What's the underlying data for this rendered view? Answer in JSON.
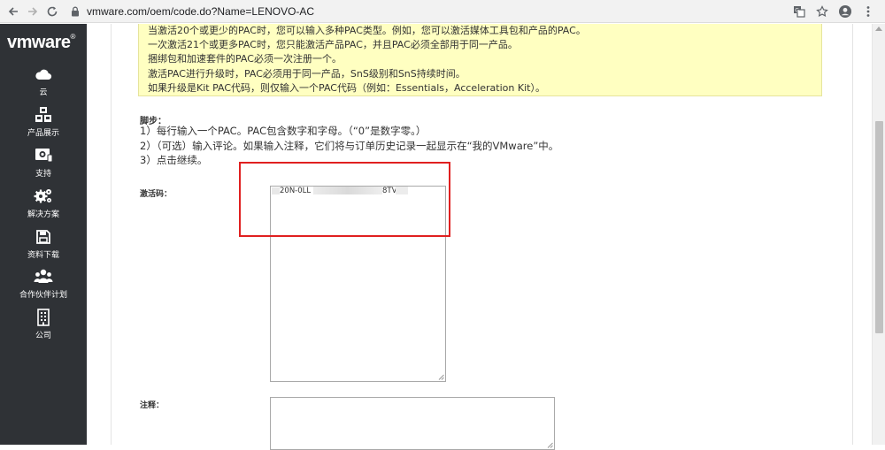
{
  "browser": {
    "url": "vmware.com/oem/code.do?Name=LENOVO-AC",
    "back_icon": "arrow-left-icon",
    "forward_icon": "arrow-right-icon",
    "reload_icon": "reload-icon"
  },
  "sidebar": {
    "logo": "vmware",
    "items": [
      {
        "label": "云",
        "icon": "cloud-icon"
      },
      {
        "label": "产品展示",
        "icon": "cubes-icon"
      },
      {
        "label": "支持",
        "icon": "support-icon"
      },
      {
        "label": "解决方案",
        "icon": "gears-icon"
      },
      {
        "label": "资料下载",
        "icon": "floppy-icon"
      },
      {
        "label": "合作伙伴计划",
        "icon": "people-icon"
      },
      {
        "label": "公司",
        "icon": "building-icon"
      }
    ]
  },
  "notice": {
    "lines": [
      "当激活20个或更少的PAC时，您可以输入多种PAC类型。例如，您可以激活媒体工具包和产品的PAC。",
      "一次激活21个或更多PAC时，您只能激活产品PAC，并且PAC必须全部用于同一产品。",
      "捆绑包和加速套件的PAC必须一次注册一个。",
      "激活PAC进行升级时，PAC必须用于同一产品，SnS级别和SnS持续时间。",
      "如果升级是Kit PAC代码，则仅输入一个PAC代码（例如：Essentials，Acceleration Kit）。"
    ]
  },
  "steps": {
    "title": "脚步：",
    "items": [
      "1）每行输入一个PAC。PAC包含数字和字母。（“0”是数字零。）",
      "2）（可选）输入评论。如果输入注释，它们将与订单历史记录一起显示在“我的VMware”中。",
      "3）点击继续。"
    ]
  },
  "form": {
    "code_label": "激活码：",
    "code_value_start": "20N-0LL",
    "code_value_end": "8TV",
    "note_label": "注释："
  },
  "colors": {
    "sidebar_bg": "#2f3236",
    "notice_bg": "#ffffc1",
    "highlight": "#e02020"
  }
}
